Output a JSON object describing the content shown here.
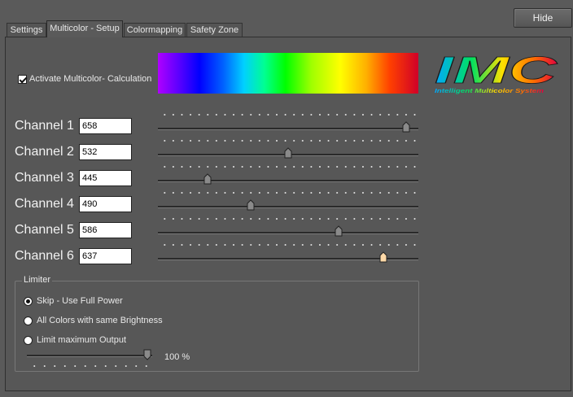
{
  "hide_label": "Hide",
  "tabs": [
    {
      "label": "Settings",
      "active": false
    },
    {
      "label": "Multicolor - Setup",
      "active": true
    },
    {
      "label": "Colormapping",
      "active": false
    },
    {
      "label": "Safety Zone",
      "active": false
    }
  ],
  "activate": {
    "label": "Activate Multicolor- Calculation",
    "checked": true
  },
  "logo": {
    "text": "IMC",
    "subtitle": "Intelligent Multicolor System",
    "icon": "imc-logo"
  },
  "channels": [
    {
      "label": "Channel 1",
      "value": "658",
      "slider": 0.97,
      "selected": false
    },
    {
      "label": "Channel 2",
      "value": "532",
      "slider": 0.5,
      "selected": false
    },
    {
      "label": "Channel 3",
      "value": "445",
      "slider": 0.18,
      "selected": false
    },
    {
      "label": "Channel 4",
      "value": "490",
      "slider": 0.35,
      "selected": false
    },
    {
      "label": "Channel 5",
      "value": "586",
      "slider": 0.7,
      "selected": false
    },
    {
      "label": "Channel 6",
      "value": "637",
      "slider": 0.88,
      "selected": true
    }
  ],
  "limiter": {
    "title": "Limiter",
    "options": [
      {
        "label": "Skip - Use Full Power",
        "selected": true
      },
      {
        "label": "All Colors with same Brightness",
        "selected": false
      },
      {
        "label": "Limit maximum Output",
        "selected": false
      }
    ],
    "output_slider": 1.0,
    "percent_label": "100 %"
  },
  "colors": {
    "thumb": "#8a8a8a",
    "thumb_selected": "#ffd9a8",
    "background": "#5a5a5a"
  }
}
